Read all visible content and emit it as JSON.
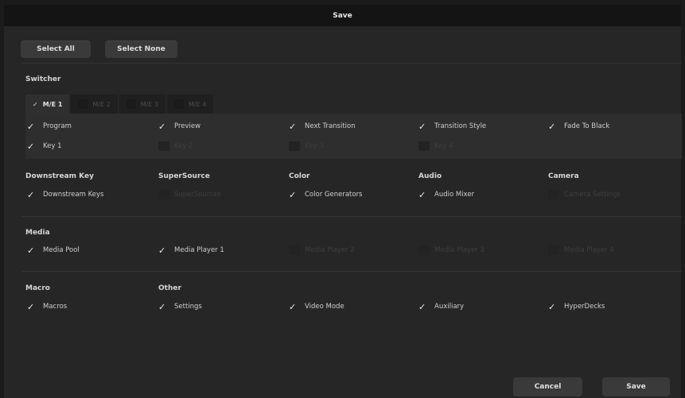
{
  "window": {
    "title": "Save"
  },
  "top_buttons": {
    "select_all": "Select All",
    "select_none": "Select None"
  },
  "switcher": {
    "title": "Switcher",
    "tabs": [
      {
        "label": "M/E 1",
        "checked": true
      },
      {
        "label": "M/E 2",
        "checked": false
      },
      {
        "label": "M/E 3",
        "checked": false
      },
      {
        "label": "M/E 4",
        "checked": false
      }
    ],
    "options": [
      {
        "label": "Program",
        "checked": true
      },
      {
        "label": "Preview",
        "checked": true
      },
      {
        "label": "Next Transition",
        "checked": true
      },
      {
        "label": "Transition Style",
        "checked": true
      },
      {
        "label": "Fade To Black",
        "checked": true
      },
      {
        "label": "Key 1",
        "checked": true
      },
      {
        "label": "Key 2",
        "checked": false
      },
      {
        "label": "Key 3",
        "checked": false
      },
      {
        "label": "Key 4",
        "checked": false
      }
    ]
  },
  "groups": [
    {
      "title": "Downstream Key",
      "options": [
        {
          "label": "Downstream Keys",
          "checked": true
        }
      ]
    },
    {
      "title": "SuperSource",
      "options": [
        {
          "label": "SuperSources",
          "checked": false
        }
      ]
    },
    {
      "title": "Color",
      "options": [
        {
          "label": "Color Generators",
          "checked": true
        }
      ]
    },
    {
      "title": "Audio",
      "options": [
        {
          "label": "Audio Mixer",
          "checked": true
        }
      ]
    },
    {
      "title": "Camera",
      "options": [
        {
          "label": "Camera Settings",
          "checked": false
        }
      ]
    }
  ],
  "media": {
    "title": "Media",
    "options": [
      {
        "label": "Media Pool",
        "checked": true
      },
      {
        "label": "Media Player 1",
        "checked": true
      },
      {
        "label": "Media Player 2",
        "checked": false
      },
      {
        "label": "Media Player 3",
        "checked": false
      },
      {
        "label": "Media Player 4",
        "checked": false
      }
    ]
  },
  "macro": {
    "title": "Macro",
    "options": [
      {
        "label": "Macros",
        "checked": true
      }
    ]
  },
  "other": {
    "title": "Other",
    "options": [
      {
        "label": "Settings",
        "checked": true
      },
      {
        "label": "Video Mode",
        "checked": true
      },
      {
        "label": "Auxiliary",
        "checked": true
      },
      {
        "label": "HyperDecks",
        "checked": true
      }
    ]
  },
  "bottom_buttons": {
    "cancel": "Cancel",
    "save": "Save"
  },
  "colors": {
    "background": "#262626",
    "titlebar": "#141414",
    "button": "#3a3a3a",
    "check": "#ececec"
  }
}
